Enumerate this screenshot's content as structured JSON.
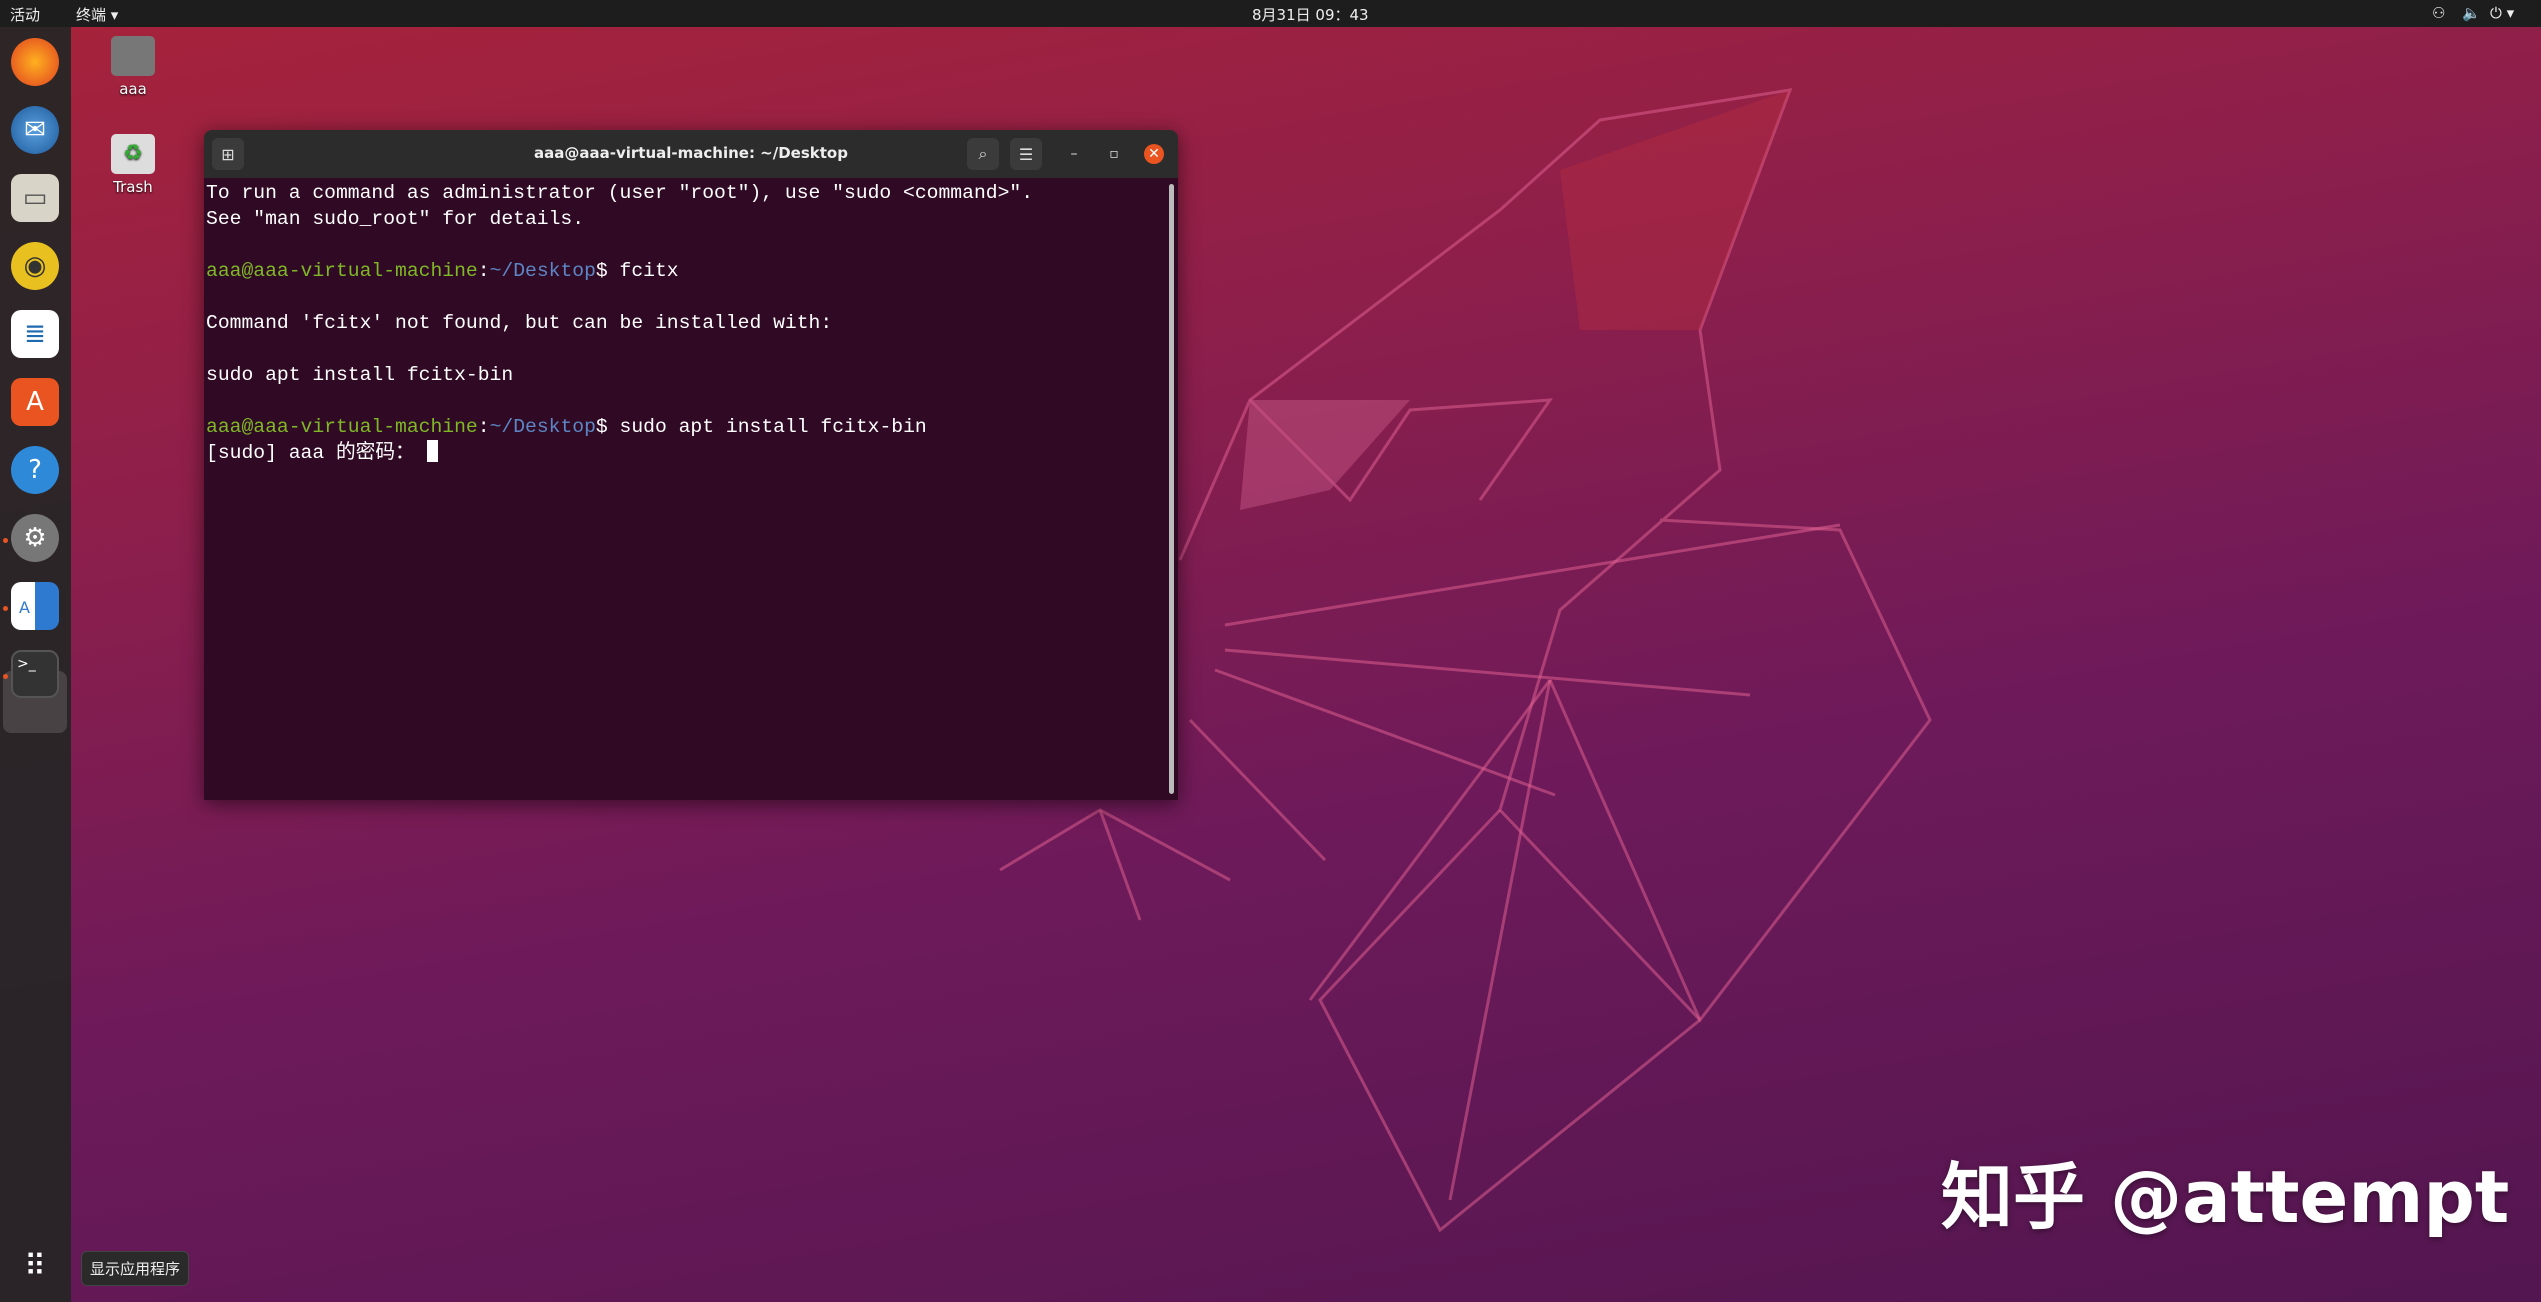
{
  "topbar": {
    "activities": "活动",
    "app_menu": "终端 ▾",
    "clock": "8月31日 09：43",
    "status_icons": [
      "network-icon",
      "volume-icon",
      "power-icon"
    ]
  },
  "dock": {
    "items": [
      "firefox",
      "thunderbird",
      "files",
      "rhythmbox",
      "libreoffice-writer",
      "software",
      "help",
      "settings",
      "language",
      "terminal"
    ],
    "apps_tooltip": "显示应用程序"
  },
  "desktop": {
    "icons": [
      {
        "label": "aaa"
      },
      {
        "label": "Trash"
      }
    ]
  },
  "terminal": {
    "title": "aaa@aaa-virtual-machine: ~/Desktop",
    "lines": {
      "l1": "To run a command as administrator (user \"root\"), use \"sudo <command>\".",
      "l2": "See \"man sudo_root\" for details.",
      "user": "aaa@aaa-virtual-machine",
      "colon": ":",
      "path": "~/Desktop",
      "dollar": "$ ",
      "cmd1": "fcitx",
      "l5": "Command 'fcitx' not found, but can be installed with:",
      "l7": "sudo apt install fcitx-bin",
      "cmd2": "sudo apt install fcitx-bin",
      "l10": "[sudo] aaa 的密码： "
    }
  },
  "watermark": "知乎 @attempt",
  "colors": {
    "terminal_bg": "#300a24",
    "prompt_user": "#7fb827",
    "prompt_path": "#5c86c6",
    "close": "#e95420",
    "arrow": "#e8202a"
  }
}
